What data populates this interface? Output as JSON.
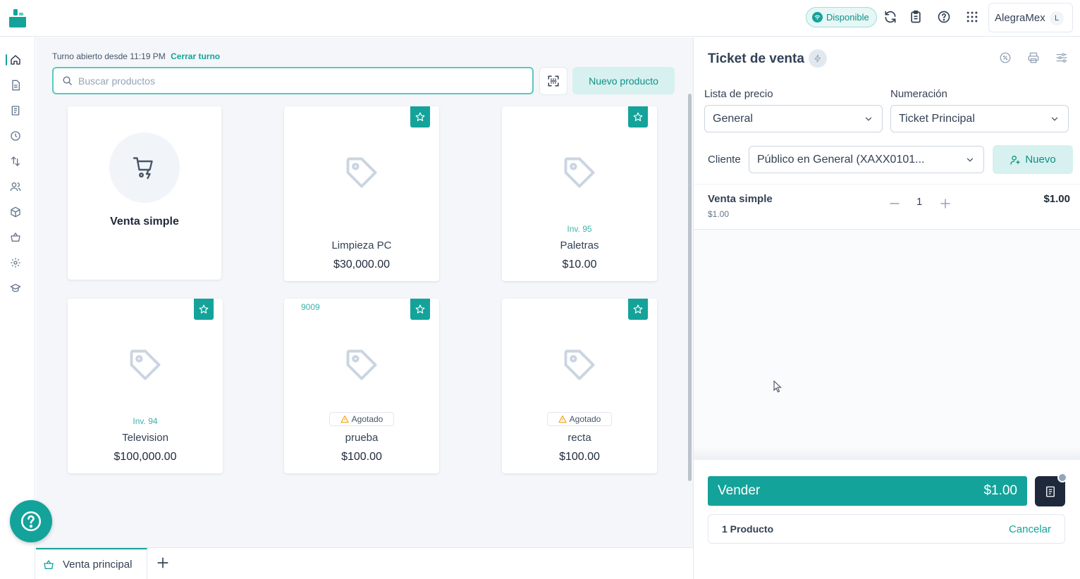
{
  "header": {
    "status_label": "Disponible",
    "company_name": "AlegraMex",
    "avatar_initial": "L",
    "icons": [
      "sync-icon",
      "clipboard-icon",
      "help-icon",
      "apps-grid-icon"
    ]
  },
  "sidenav": {
    "items": [
      "home-icon",
      "document-icon",
      "receipt-icon",
      "clock-icon",
      "transfer-icon",
      "users-icon",
      "box-icon",
      "basket-icon",
      "gear-icon",
      "graduation-cap-icon"
    ]
  },
  "shift": {
    "text": "Turno abierto desde 11:19 PM",
    "close_link": "Cerrar turno"
  },
  "search": {
    "placeholder": "Buscar productos",
    "value": ""
  },
  "toolbar": {
    "new_product_label": "Nuevo producto"
  },
  "products": {
    "simple": {
      "name": "Venta simple"
    },
    "items": [
      {
        "name": "Limpieza PC",
        "price": "$30,000.00",
        "inv": "",
        "code": "",
        "badge": ""
      },
      {
        "name": "Paletras",
        "price": "$10.00",
        "inv": "Inv. 95",
        "code": "",
        "badge": ""
      },
      {
        "name": "Television",
        "price": "$100,000.00",
        "inv": "Inv. 94",
        "code": "",
        "badge": ""
      },
      {
        "name": "prueba",
        "price": "$100.00",
        "inv": "",
        "code": "9009",
        "badge": "Agotado"
      },
      {
        "name": "recta",
        "price": "$100.00",
        "inv": "",
        "code": "",
        "badge": "Agotado"
      }
    ]
  },
  "tabs": {
    "active_label": "Venta principal"
  },
  "ticket": {
    "title": "Ticket de venta",
    "price_list_label": "Lista de precio",
    "price_list_value": "General",
    "numbering_label": "Numeración",
    "numbering_value": "Ticket Principal",
    "client_label": "Cliente",
    "client_value": "Público en General (XAXX0101...",
    "new_client_label": "Nuevo",
    "line": {
      "name": "Venta simple",
      "unit_price": "$1.00",
      "qty": "1",
      "total": "$1.00"
    },
    "sell_label": "Vender",
    "sell_total": "$1.00",
    "product_count": "1 Producto",
    "cancel_label": "Cancelar"
  },
  "colors": {
    "accent": "#14a39a",
    "accent_light": "#d6f1ef",
    "dark": "#1e293b"
  }
}
